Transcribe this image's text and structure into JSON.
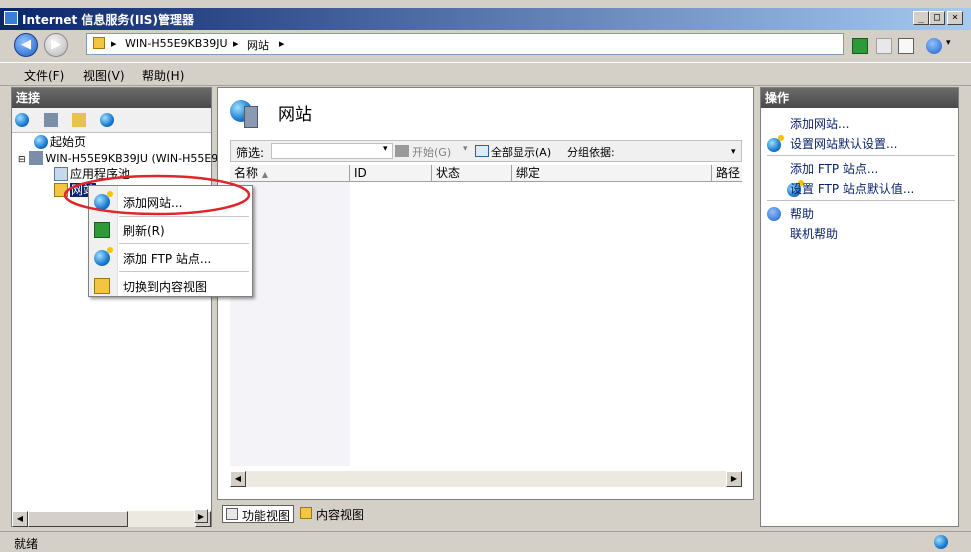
{
  "window": {
    "title": "Internet 信息服务(IIS)管理器"
  },
  "address": {
    "crumbs": [
      "WIN-H55E9KB39JU",
      "网站"
    ]
  },
  "menu": {
    "file": "文件(F)",
    "view": "视图(V)",
    "help": "帮助(H)"
  },
  "connections": {
    "header": "连接",
    "tree": {
      "start": "起始页",
      "server": "WIN-H55E9KB39JU (WIN-H55E9",
      "app_pools": "应用程序池",
      "sites": "网站"
    }
  },
  "center": {
    "title": "网站",
    "filter_label": "筛选:",
    "start_button": "开始(G)",
    "show_all": "全部显示(A)",
    "group_by": "分组依据:",
    "columns": [
      "名称",
      "ID",
      "状态",
      "绑定",
      "路径"
    ],
    "tabs": {
      "features": "功能视图",
      "content": "内容视图"
    }
  },
  "actions": {
    "header": "操作",
    "add_site": "添加网站...",
    "set_site_defaults": "设置网站默认设置...",
    "add_ftp": "添加 FTP 站点...",
    "set_ftp_defaults": "设置 FTP 站点默认值...",
    "help": "帮助",
    "online_help": "联机帮助"
  },
  "context_menu": {
    "add_site": "添加网站...",
    "refresh": "刷新(R)",
    "add_ftp": "添加 FTP 站点...",
    "switch_content": "切换到内容视图"
  },
  "status": {
    "text": "就绪"
  },
  "colors": {
    "annotation_circle": "#e0262c",
    "title_gradient_start": "#0a246a"
  }
}
